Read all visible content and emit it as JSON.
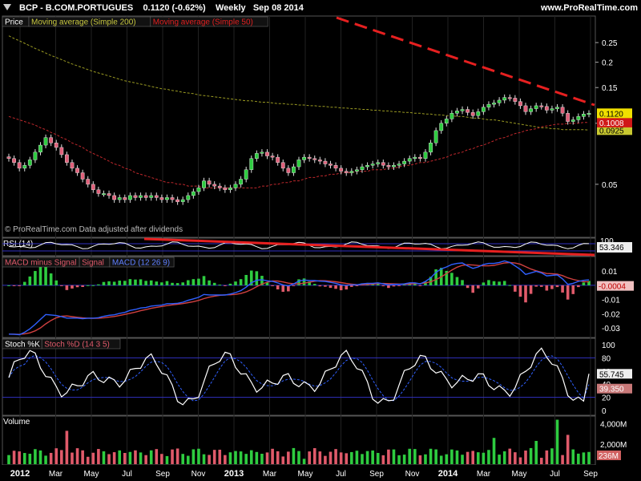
{
  "header": {
    "symbol": "BCP - B.COM.PORTUGUES",
    "quote": "0.1120 (-0.62%)",
    "period": "Weekly",
    "date": "Sep 08 2014",
    "site": "www.ProRealTime.com"
  },
  "chart_data": [
    {
      "type": "candlestick",
      "panel": "price",
      "legend": [
        "Price",
        "Moving average (Simple 200)",
        "Moving average (Simple 50)"
      ],
      "footer": "© ProRealTime.com  Data adjusted after dividends",
      "yscale": "log",
      "ylim": [
        0.03,
        0.32
      ],
      "ticks": [
        "0.25",
        "0.2",
        "0.15",
        "0.1",
        "0.05"
      ],
      "tick_values": [
        0.25,
        0.2,
        0.15,
        0.1,
        0.05
      ],
      "last_labels": {
        "price": "0.1120",
        "ma50": "0.1008",
        "ma200": "0.0925"
      },
      "x_labels": [
        "2012",
        "Mar",
        "May",
        "Jul",
        "Sep",
        "Nov",
        "2013",
        "Mar",
        "May",
        "Jul",
        "Sep",
        "Nov",
        "2014",
        "Mar",
        "May",
        "Jul",
        "Sep"
      ],
      "colors": {
        "up": "#2ecc40",
        "down": "#e0607a",
        "ma200": "#9a9a22",
        "ma50": "#c0282c",
        "trend": "#e62020"
      },
      "close": [
        0.067,
        0.064,
        0.06,
        0.062,
        0.066,
        0.072,
        0.078,
        0.085,
        0.08,
        0.076,
        0.07,
        0.064,
        0.06,
        0.057,
        0.053,
        0.05,
        0.047,
        0.045,
        0.045,
        0.044,
        0.042,
        0.043,
        0.042,
        0.044,
        0.043,
        0.044,
        0.043,
        0.044,
        0.043,
        0.042,
        0.043,
        0.042,
        0.041,
        0.042,
        0.044,
        0.046,
        0.048,
        0.052,
        0.05,
        0.049,
        0.048,
        0.047,
        0.048,
        0.05,
        0.053,
        0.059,
        0.067,
        0.071,
        0.072,
        0.069,
        0.068,
        0.064,
        0.06,
        0.057,
        0.061,
        0.066,
        0.068,
        0.067,
        0.066,
        0.065,
        0.063,
        0.062,
        0.06,
        0.058,
        0.057,
        0.058,
        0.059,
        0.061,
        0.062,
        0.063,
        0.064,
        0.062,
        0.061,
        0.062,
        0.063,
        0.065,
        0.067,
        0.068,
        0.067,
        0.072,
        0.08,
        0.092,
        0.1,
        0.105,
        0.112,
        0.115,
        0.117,
        0.113,
        0.109,
        0.114,
        0.12,
        0.124,
        0.126,
        0.13,
        0.134,
        0.133,
        0.128,
        0.122,
        0.114,
        0.118,
        0.122,
        0.121,
        0.116,
        0.118,
        0.12,
        0.112,
        0.102,
        0.104,
        0.108,
        0.111,
        0.112
      ],
      "ma50": [
        0.108,
        0.106,
        0.104,
        0.102,
        0.1,
        0.098,
        0.095,
        0.093,
        0.09,
        0.088,
        0.085,
        0.083,
        0.08,
        0.078,
        0.076,
        0.073,
        0.071,
        0.069,
        0.067,
        0.065,
        0.063,
        0.062,
        0.06,
        0.059,
        0.057,
        0.056,
        0.055,
        0.054,
        0.053,
        0.052,
        0.051,
        0.051,
        0.05,
        0.05,
        0.049,
        0.049,
        0.049,
        0.048,
        0.048,
        0.048,
        0.048,
        0.048,
        0.048,
        0.048,
        0.048,
        0.048,
        0.048,
        0.048,
        0.049,
        0.049,
        0.05,
        0.05,
        0.051,
        0.051,
        0.052,
        0.052,
        0.053,
        0.054,
        0.054,
        0.055,
        0.055,
        0.056,
        0.056,
        0.057,
        0.057,
        0.057,
        0.058,
        0.058,
        0.058,
        0.059,
        0.059,
        0.059,
        0.06,
        0.06,
        0.061,
        0.062,
        0.062,
        0.063,
        0.064,
        0.064,
        0.065,
        0.066,
        0.067,
        0.068,
        0.07,
        0.071,
        0.072,
        0.074,
        0.075,
        0.077,
        0.078,
        0.08,
        0.082,
        0.084,
        0.085,
        0.087,
        0.089,
        0.09,
        0.092,
        0.093,
        0.094,
        0.096,
        0.097,
        0.098,
        0.099,
        0.099,
        0.1,
        0.1,
        0.1,
        0.101,
        0.101
      ],
      "ma200": [
        0.27,
        0.262,
        0.255,
        0.248,
        0.241,
        0.234,
        0.228,
        0.222,
        0.216,
        0.211,
        0.206,
        0.201,
        0.196,
        0.192,
        0.188,
        0.184,
        0.18,
        0.177,
        0.174,
        0.171,
        0.168,
        0.165,
        0.162,
        0.16,
        0.158,
        0.156,
        0.154,
        0.152,
        0.15,
        0.148,
        0.147,
        0.145,
        0.144,
        0.142,
        0.141,
        0.14,
        0.138,
        0.137,
        0.136,
        0.135,
        0.134,
        0.133,
        0.132,
        0.131,
        0.13,
        0.129,
        0.129,
        0.128,
        0.127,
        0.127,
        0.126,
        0.125,
        0.125,
        0.124,
        0.124,
        0.123,
        0.123,
        0.122,
        0.122,
        0.121,
        0.121,
        0.12,
        0.12,
        0.119,
        0.119,
        0.118,
        0.118,
        0.117,
        0.117,
        0.116,
        0.116,
        0.115,
        0.115,
        0.114,
        0.114,
        0.113,
        0.113,
        0.112,
        0.112,
        0.111,
        0.111,
        0.11,
        0.11,
        0.109,
        0.109,
        0.108,
        0.108,
        0.107,
        0.106,
        0.106,
        0.105,
        0.104,
        0.104,
        0.103,
        0.102,
        0.101,
        0.1,
        0.099,
        0.098,
        0.097,
        0.096,
        0.095,
        0.095,
        0.094,
        0.094,
        0.093,
        0.093,
        0.093,
        0.093,
        0.093,
        0.0925
      ]
    },
    {
      "type": "line",
      "panel": "RSI",
      "legend": [
        "RSI (14)"
      ],
      "last_value": "53.346",
      "tick_top": "100"
    },
    {
      "type": "histogram+line",
      "panel": "MACD",
      "legend": [
        "MACD minus Signal",
        "Signal",
        "MACD (12 26 9)"
      ],
      "ticks": [
        "0.01",
        "0",
        "-0.01",
        "-0.02",
        "-0.03"
      ],
      "tick_values": [
        0.01,
        0,
        -0.01,
        -0.02,
        -0.03
      ],
      "last_value": "-0.0004",
      "ylim": [
        -0.035,
        0.018
      ]
    },
    {
      "type": "line",
      "panel": "Stochastic",
      "legend": [
        "Stoch %K",
        "Stoch %D (14 3 5)"
      ],
      "ticks": [
        "100",
        "80",
        "60",
        "40",
        "20",
        "0"
      ],
      "tick_values": [
        100,
        80,
        60,
        40,
        20,
        0
      ],
      "last_k": "55.745",
      "last_d": "39.350",
      "ylim": [
        0,
        100
      ],
      "bands": [
        80,
        20
      ]
    },
    {
      "type": "bar",
      "panel": "Volume",
      "legend": [
        "Volume"
      ],
      "ticks": [
        "4,000M",
        "2,000M"
      ],
      "tick_values": [
        4000,
        2000
      ],
      "last_value": "236M",
      "ylim": [
        0,
        4600
      ]
    }
  ]
}
